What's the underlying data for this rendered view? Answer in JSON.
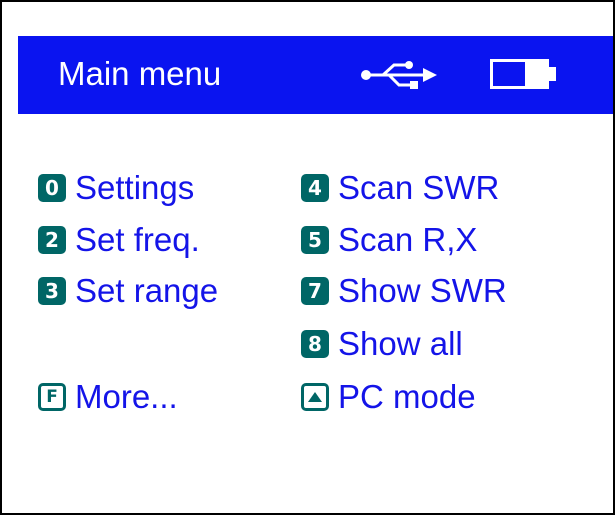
{
  "title_bar": {
    "title": "Main menu",
    "connection_icon": "usb-icon",
    "power_icon": "battery-icon",
    "background_color": "#0a14f0"
  },
  "menu": {
    "key_color": "#006666",
    "label_color": "#1414e8",
    "left_column": [
      {
        "key": "0",
        "label": "Settings"
      },
      {
        "key": "2",
        "label": "Set freq."
      },
      {
        "key": "3",
        "label": "Set range"
      },
      {
        "key": "F",
        "label": "More..."
      }
    ],
    "right_column": [
      {
        "key": "4",
        "label": "Scan SWR"
      },
      {
        "key": "5",
        "label": "Scan R,X"
      },
      {
        "key": "7",
        "label": "Show SWR"
      },
      {
        "key": "8",
        "label": "Show all"
      },
      {
        "key": "up-arrow-icon",
        "label": "PC mode"
      }
    ]
  }
}
